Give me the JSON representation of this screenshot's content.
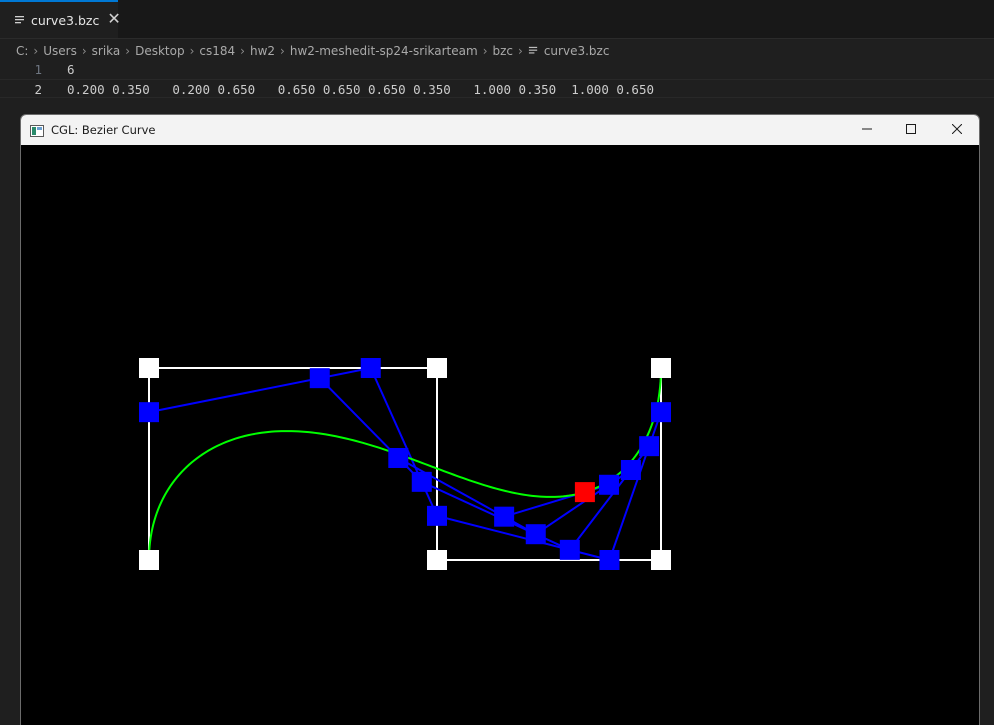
{
  "editor": {
    "tab": {
      "label": "curve3.bzc",
      "close_glyph": "✕",
      "icon": "file-lines-icon"
    },
    "breadcrumb": {
      "items": [
        "C:",
        "Users",
        "srika",
        "Desktop",
        "cs184",
        "hw2",
        "hw2-meshedit-sp24-srikarteam",
        "bzc",
        "curve3.bzc"
      ],
      "separator": "›"
    },
    "lines": [
      {
        "number": "1",
        "text": "6"
      },
      {
        "number": "2",
        "text": "0.200 0.350   0.200 0.650   0.650 0.650 0.650 0.350   1.000 0.350  1.000 0.650"
      }
    ],
    "current_line": 2
  },
  "cgl_window": {
    "title": "CGL: Bezier Curve",
    "controls": [
      "minimize-icon",
      "maximize-icon",
      "close-icon"
    ],
    "colors": {
      "background": "#000000",
      "control_polygon": "#ffffff",
      "intermediate_polygon": "#0000ff",
      "curve": "#00ff00",
      "evaluated_point": "#ff0000"
    },
    "scene": {
      "control_points": [
        [
          0.2,
          0.35
        ],
        [
          0.2,
          0.65
        ],
        [
          0.65,
          0.65
        ],
        [
          0.65,
          0.35
        ],
        [
          1.0,
          0.35
        ],
        [
          1.0,
          0.65
        ]
      ],
      "t": 0.77
    }
  }
}
